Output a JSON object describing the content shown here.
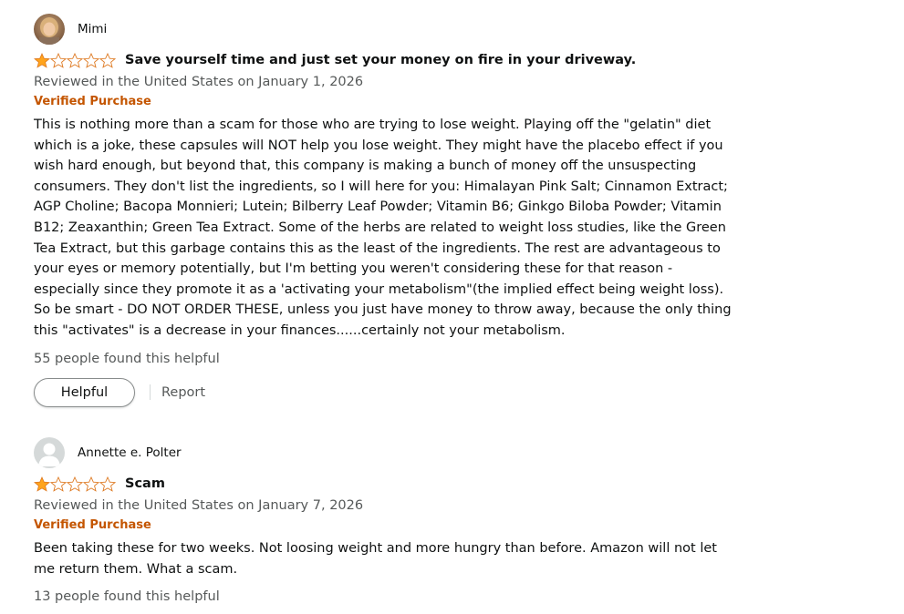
{
  "reviews": [
    {
      "author": "Mimi",
      "avatar": "user-photo",
      "rating": 1,
      "rating_max": 5,
      "title": "Save yourself time and just set your money on fire in your driveway.",
      "date_line": "Reviewed in the United States on January 1, 2026",
      "verified": "Verified Purchase",
      "body": "This is nothing more than a scam for those who are trying to lose weight. Playing off the \"gelatin\" diet which is a joke, these capsules will NOT help you lose weight. They might have the placebo effect if you wish hard enough, but beyond that, this company is making a bunch of money off the unsuspecting consumers. They don't list the ingredients, so I will here for you: Himalayan Pink Salt; Cinnamon Extract; AGP Choline; Bacopa Monnieri; Lutein; Bilberry Leaf Powder; Vitamin B6; Ginkgo Biloba Powder; Vitamin B12; Zeaxanthin; Green Tea Extract. Some of the herbs are related to weight loss studies, like the Green Tea Extract, but this garbage contains this as the least of the ingredients. The rest are advantageous to your eyes or memory potentially, but I'm betting you weren't considering these for that reason - especially since they promote it as a 'activating your metabolism\"(the implied effect being weight loss). So be smart - DO NOT ORDER THESE, unless you just have money to throw away, because the only thing this \"activates\" is a decrease in your finances......certainly not your metabolism.",
      "helpful_count": "55 people found this helpful",
      "helpful_button": "Helpful",
      "report_link": "Report"
    },
    {
      "author": "Annette e. Polter",
      "avatar": "default-user-icon",
      "rating": 1,
      "rating_max": 5,
      "title": "Scam",
      "date_line": "Reviewed in the United States on January 7, 2026",
      "verified": "Verified Purchase",
      "body": "Been taking these for two weeks. Not loosing weight and more hungry than before. Amazon will not let me return them. What a scam.",
      "helpful_count": "13 people found this helpful"
    }
  ],
  "colors": {
    "star_fill": "#ffa41c",
    "star_outline": "#de7921",
    "verified": "#c45500",
    "muted": "#565959"
  }
}
